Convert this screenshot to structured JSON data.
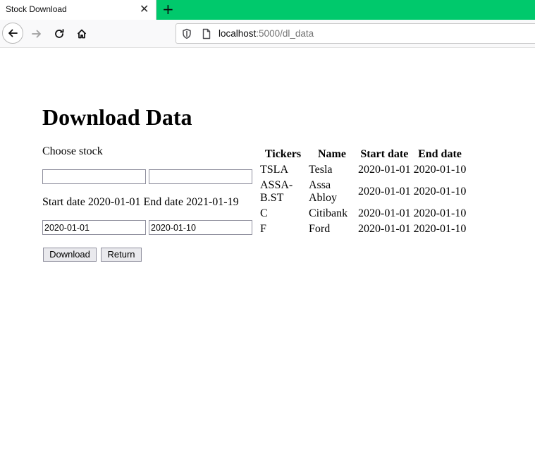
{
  "browser": {
    "tab_title": "Stock Download",
    "tab_close": "✕",
    "new_tab": "+",
    "url_host": "localhost",
    "url_rest": ":5000/dl_data"
  },
  "page": {
    "title": "Download Data",
    "choose_label": "Choose stock",
    "ticker_input_1": "",
    "ticker_input_2": "",
    "range_text": "Start date 2020-01-01 End date 2021-01-19",
    "start_date_value": "2020-01-01",
    "end_date_value": "2020-01-10",
    "download_label": "Download",
    "return_label": "Return"
  },
  "table": {
    "headers": [
      "Tickers",
      "Name",
      "Start date",
      "End date"
    ],
    "rows": [
      [
        "TSLA",
        "Tesla",
        "2020-01-01",
        "2020-01-10"
      ],
      [
        "ASSA-B.ST",
        "Assa Abloy",
        "2020-01-01",
        "2020-01-10"
      ],
      [
        "C",
        "Citibank",
        "2020-01-01",
        "2020-01-10"
      ],
      [
        "F",
        "Ford",
        "2020-01-01",
        "2020-01-10"
      ]
    ]
  },
  "colors": {
    "tabbar_accent": "#00c96c"
  }
}
